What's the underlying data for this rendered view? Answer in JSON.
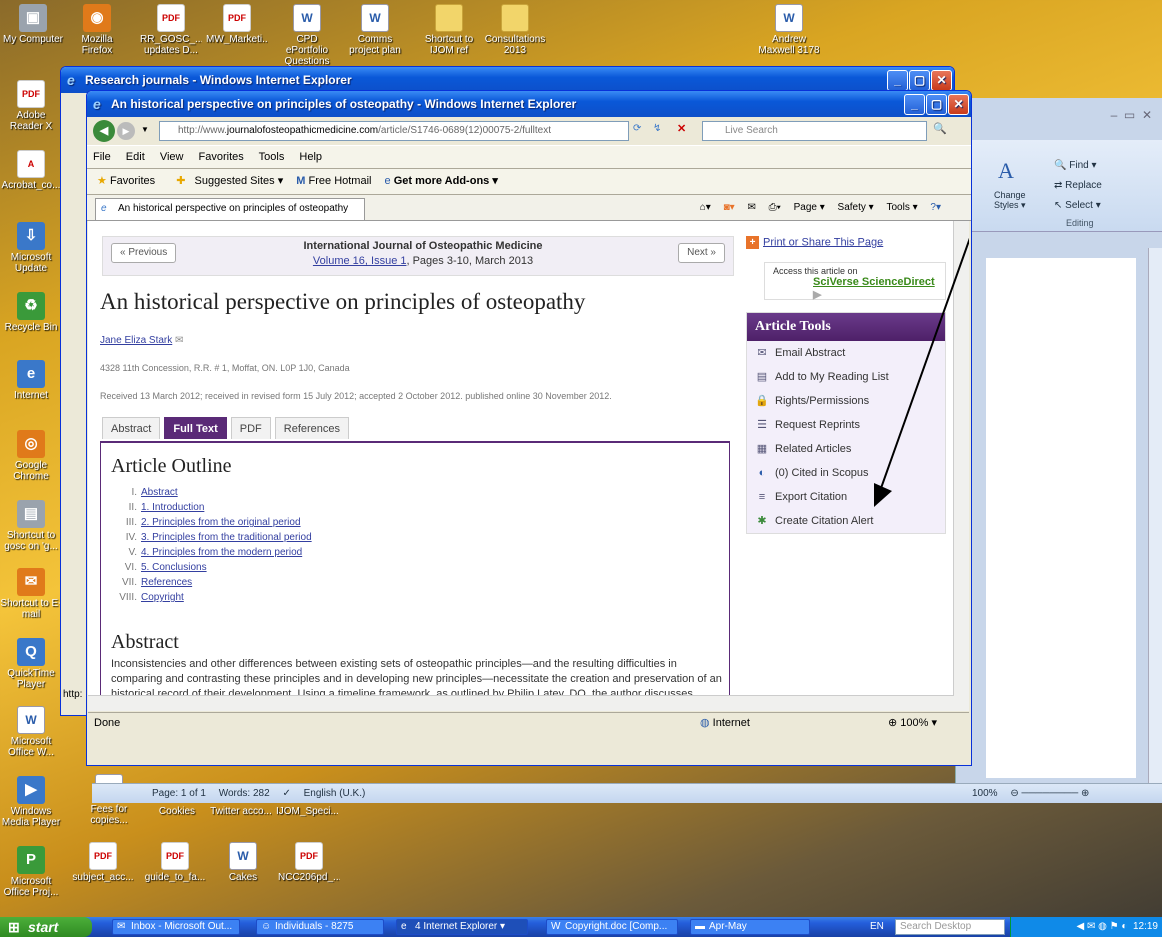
{
  "desktop_icons_top": [
    {
      "label": "My Computer",
      "icon": "computer-icon"
    },
    {
      "label": "Mozilla Firefox",
      "icon": "firefox-icon"
    },
    {
      "label": "RR_GOSC_... updates D...",
      "icon": "pdf-icon"
    },
    {
      "label": "MW_Marketi...",
      "icon": "pdf-icon"
    },
    {
      "label": "CPD ePortfolio Questions",
      "icon": "word-icon"
    },
    {
      "label": "Comms project plan",
      "icon": "word-icon"
    },
    {
      "label": "Shortcut to IJOM ref",
      "icon": "folder-icon"
    },
    {
      "label": "Consultations 2013",
      "icon": "folder-icon"
    },
    {
      "label": "Andrew Maxwell 3178",
      "icon": "word-icon"
    }
  ],
  "desktop_icons_left": [
    {
      "label": "Adobe Reader X",
      "icon": "pdf-icon"
    },
    {
      "label": "Acrobat_co...",
      "icon": "acrobat-icon"
    },
    {
      "label": "Microsoft Update",
      "icon": "update-icon"
    },
    {
      "label": "Recycle Bin",
      "icon": "recycle-bin-icon"
    },
    {
      "label": "Internet",
      "icon": "ie-icon"
    },
    {
      "label": "Google Chrome",
      "icon": "chrome-icon"
    },
    {
      "label": "Shortcut to gosc on 'g...",
      "icon": "network-drive-icon"
    },
    {
      "label": "Shortcut to E-mail",
      "icon": "email-icon"
    },
    {
      "label": "QuickTime Player",
      "icon": "quicktime-icon"
    },
    {
      "label": "Microsoft Office W...",
      "icon": "word-icon"
    },
    {
      "label": "Windows Media Player",
      "icon": "media-player-icon"
    },
    {
      "label": "Microsoft Office Proj...",
      "icon": "project-icon"
    }
  ],
  "desktop_icons_bottom_row1": [
    {
      "label": "Fees for copies...",
      "icon": "word-icon"
    },
    {
      "label": "Cookies",
      "icon": "word-icon"
    },
    {
      "label": "Twitter acco...",
      "icon": "word-icon"
    },
    {
      "label": "IJOM_Speci...",
      "icon": "word-icon"
    }
  ],
  "desktop_icons_bottom_row2": [
    {
      "label": "subject_acc...",
      "icon": "pdf-icon"
    },
    {
      "label": "guide_to_fa...",
      "icon": "pdf-icon"
    },
    {
      "label": "Cakes",
      "icon": "word-icon"
    },
    {
      "label": "NCC206pd_...",
      "icon": "pdf-icon"
    }
  ],
  "back_ie_window": {
    "title": "Research journals - Windows Internet Explorer",
    "status_url": "http:"
  },
  "ie_window": {
    "title": "An historical perspective on principles of osteopathy - Windows Internet Explorer",
    "address_prefix": "http://www.",
    "address_domain": "journalofosteopathicmedicine.com",
    "address_suffix": "/article/S1746-0689(12)00075-2/fulltext",
    "search_placeholder": "Live Search",
    "menu": [
      "File",
      "Edit",
      "View",
      "Favorites",
      "Tools",
      "Help"
    ],
    "favorites_label": "Favorites",
    "suggested_sites": "Suggested Sites ▾",
    "free_hotmail": "Free Hotmail",
    "get_addons": "Get more Add-ons ▾",
    "tab_title": "An historical perspective on principles of osteopathy",
    "page_menu": "Page ▾",
    "safety_menu": "Safety ▾",
    "tools_menu": "Tools ▾",
    "status_left": "Done",
    "zone": "Internet",
    "zoom": "100%"
  },
  "article": {
    "prev": "« Previous",
    "next": "Next »",
    "journal": "International Journal of Osteopathic Medicine",
    "volume_link": "Volume 16, Issue 1",
    "pages": ", Pages 3-10, March 2013",
    "title": "An historical perspective on principles of osteopathy",
    "author": "Jane Eliza Stark",
    "address": "4328 11th Concession, R.R. # 1, Moffat, ON. L0P 1J0, Canada",
    "received": "Received 13 March 2012; received in revised form 15 July 2012; accepted 2 October 2012. published online 30 November 2012.",
    "tabs": [
      "Abstract",
      "Full Text",
      "PDF",
      "References"
    ],
    "active_tab": "Full Text",
    "outline_heading": "Article Outline",
    "outline": [
      {
        "num": "I.",
        "text": "Abstract"
      },
      {
        "num": "II.",
        "text": "1. Introduction"
      },
      {
        "num": "III.",
        "text": "2. Principles from the original period"
      },
      {
        "num": "IV.",
        "text": "3. Principles from the traditional period"
      },
      {
        "num": "V.",
        "text": "4. Principles from the modern period"
      },
      {
        "num": "VI.",
        "text": "5. Conclusions"
      },
      {
        "num": "VII.",
        "text": "References"
      },
      {
        "num": "VIII.",
        "text": "Copyright"
      }
    ],
    "abstract_heading": "Abstract",
    "abstract_text": "Inconsistencies and other differences between existing sets of osteopathic principles—and the resulting difficulties in comparing and contrasting these principles and in developing new principles—necessitate the creation and preservation of an historical record of their development. Using a timeline framework, as outlined by Philip Latey, DO, the author discusses"
  },
  "sidebar": {
    "print_share": "Print or Share This Page",
    "access_text": "Access this article on",
    "sciverse": "SciVerse ScienceDirect",
    "tools_heading": "Article Tools",
    "tools": [
      {
        "label": "Email Abstract",
        "icon": "email-icon"
      },
      {
        "label": "Add to My Reading List",
        "icon": "reading-list-icon"
      },
      {
        "label": "Rights/Permissions",
        "icon": "lock-icon"
      },
      {
        "label": "Request Reprints",
        "icon": "reprint-icon"
      },
      {
        "label": "Related Articles",
        "icon": "related-icon"
      },
      {
        "label": "(0) Cited in Scopus",
        "icon": "scopus-icon"
      },
      {
        "label": "Export Citation",
        "icon": "export-icon"
      },
      {
        "label": "Create Citation Alert",
        "icon": "alert-icon"
      }
    ]
  },
  "word": {
    "find": "Find ▾",
    "replace": "Replace",
    "select": "Select ▾",
    "change_styles": "Change Styles ▾",
    "editing": "Editing",
    "status_page": "Page: 1 of 1",
    "status_words": "Words: 282",
    "status_lang": "English (U.K.)",
    "zoom": "100%"
  },
  "taskbar": {
    "start": "start",
    "tasks": [
      {
        "label": "Inbox - Microsoft Out...",
        "icon": "outlook-icon"
      },
      {
        "label": "Individuals - 8275",
        "icon": "contacts-icon"
      },
      {
        "label": "4 Internet Explorer ▾",
        "icon": "ie-icon"
      },
      {
        "label": "Copyright.doc [Comp...",
        "icon": "word-icon"
      },
      {
        "label": "Apr-May",
        "icon": "folder-icon"
      }
    ],
    "lang": "EN",
    "search_placeholder": "Search Desktop",
    "clock": "12:19"
  }
}
